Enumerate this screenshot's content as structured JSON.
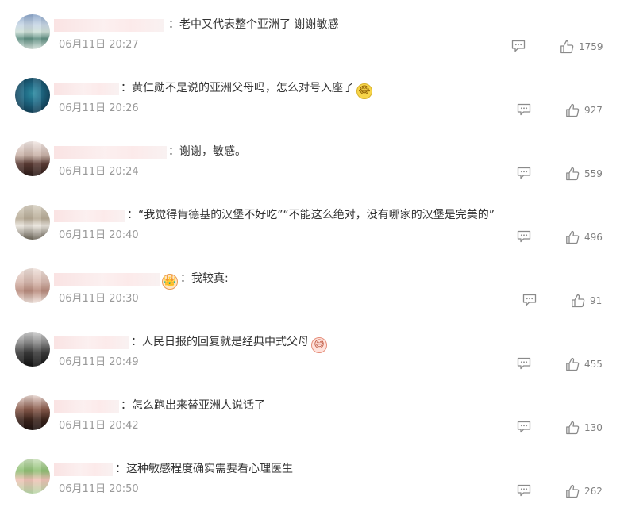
{
  "colors": {
    "text": "#333333",
    "time": "#999999",
    "icon": "#8a8a8a",
    "count": "#808080"
  },
  "icons": {
    "reply": "comment-bubble-icon",
    "like": "thumbs-up-icon"
  },
  "comments": [
    {
      "text": "：老中又代表整个亚洲了 谢谢敏感",
      "time": "06月11日 20:27",
      "likes": "1759"
    },
    {
      "text": "：黄仁勋不是说的亚洲父母吗，怎么对号入座了",
      "time": "06月11日 20:26",
      "likes": "927",
      "emoji": "crying-laughing-emoji"
    },
    {
      "text": "：谢谢，敏感。",
      "time": "06月11日 20:24",
      "likes": "559"
    },
    {
      "text": "：“我觉得肯德基的汉堡不好吃”“不能这么绝对，没有哪家的汉堡是完美的”",
      "time": "06月11日 20:40",
      "likes": "496"
    },
    {
      "text": "：我较真:",
      "time": "06月11日 20:30",
      "likes": "91",
      "badge": "crown-badge"
    },
    {
      "text": "：人民日报的回复就是经典中式父母",
      "time": "06月11日 20:49",
      "likes": "455",
      "emoji": "sweat-smile-emoji"
    },
    {
      "text": "：怎么跑出来替亚洲人说话了",
      "time": "06月11日 20:42",
      "likes": "130"
    },
    {
      "text": "：这种敏感程度确实需要看心理医生",
      "time": "06月11日 20:50",
      "likes": "262"
    }
  ]
}
